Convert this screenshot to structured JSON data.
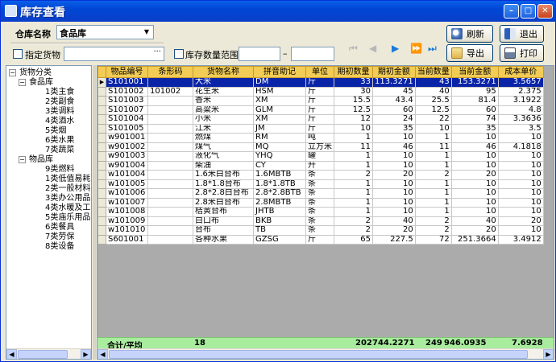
{
  "window": {
    "title": "库存查看"
  },
  "filters": {
    "warehouse_label": "仓库名称",
    "warehouse_value": "食品库",
    "specify_goods_label": "指定货物",
    "specify_goods_value": "",
    "browse_glyph": "···",
    "stock_range_label": "库存数量范围",
    "range_dash": "–",
    "range_min": "",
    "range_max": ""
  },
  "buttons": {
    "refresh": "刷新",
    "exit": "退出",
    "export": "导出",
    "print": "打印"
  },
  "tree": {
    "root": "货物分类",
    "groups": [
      {
        "label": "食品库",
        "children": [
          "1类主食",
          "2类副食",
          "3类调料",
          "4类酒水",
          "5类烟",
          "6类水果",
          "7类蔬菜"
        ]
      },
      {
        "label": "物品库",
        "children": [
          "9类燃料",
          "1类低值易耗",
          "2类一般材料",
          "3类办公用品",
          "4类水暖及工",
          "5类庙乐用品",
          "6类餐具",
          "7类劳保",
          "8类设备"
        ]
      }
    ]
  },
  "grid": {
    "columns": [
      "物品编号",
      "条形码",
      "货物名称",
      "拼音助记",
      "单位",
      "期初数量",
      "期初金额",
      "当前数量",
      "当前金额",
      "成本单价"
    ],
    "rows": [
      [
        "S101001",
        "",
        "大米",
        "DM",
        "斤",
        "33",
        "113.3271",
        "43",
        "153.3271",
        "3.5657"
      ],
      [
        "S101002",
        "101002",
        "花生米",
        "HSM",
        "斤",
        "30",
        "45",
        "40",
        "95",
        "2.375"
      ],
      [
        "S101003",
        "",
        "香米",
        "XM",
        "斤",
        "15.5",
        "43.4",
        "25.5",
        "81.4",
        "3.1922"
      ],
      [
        "S101007",
        "",
        "高粱米",
        "GLM",
        "斤",
        "12.5",
        "60",
        "12.5",
        "60",
        "4.8"
      ],
      [
        "S101004",
        "",
        "小米",
        "XM",
        "斤",
        "12",
        "24",
        "22",
        "74",
        "3.3636"
      ],
      [
        "S101005",
        "",
        "江米",
        "JM",
        "斤",
        "10",
        "35",
        "10",
        "35",
        "3.5"
      ],
      [
        "w901001",
        "",
        "燃煤",
        "RM",
        "吨",
        "1",
        "10",
        "1",
        "10",
        "10"
      ],
      [
        "w901002",
        "",
        "煤气",
        "MQ",
        "立方米",
        "11",
        "46",
        "11",
        "46",
        "4.1818"
      ],
      [
        "w901003",
        "",
        "液化气",
        "YHQ",
        "罐",
        "1",
        "10",
        "1",
        "10",
        "10"
      ],
      [
        "w901004",
        "",
        "柴油",
        "CY",
        "升",
        "1",
        "10",
        "1",
        "10",
        "10"
      ],
      [
        "w101004",
        "",
        "1.6米白台布",
        "1.6MBTB",
        "条",
        "2",
        "20",
        "2",
        "20",
        "10"
      ],
      [
        "w101005",
        "",
        "1.8*1.8台布",
        "1.8*1.8TB",
        "条",
        "1",
        "10",
        "1",
        "10",
        "10"
      ],
      [
        "w101006",
        "",
        "2.8*2.8白台布",
        "2.8*2.8BTB",
        "条",
        "1",
        "10",
        "1",
        "10",
        "10"
      ],
      [
        "w101007",
        "",
        "2.8米白台布",
        "2.8MBTB",
        "条",
        "1",
        "10",
        "1",
        "10",
        "10"
      ],
      [
        "w101008",
        "",
        "桔黄台布",
        "JHTB",
        "条",
        "1",
        "10",
        "1",
        "10",
        "10"
      ],
      [
        "w101009",
        "",
        "白口布",
        "BKB",
        "条",
        "2",
        "40",
        "2",
        "40",
        "20"
      ],
      [
        "w101010",
        "",
        "台布",
        "TB",
        "条",
        "2",
        "20",
        "2",
        "20",
        "10"
      ],
      [
        "S601001",
        "",
        "各种水果",
        "GZSG",
        "斤",
        "65",
        "227.5",
        "72",
        "251.3664",
        "3.4912"
      ]
    ],
    "selected_row": 0,
    "footer": {
      "label": "合计/平均",
      "count": "18",
      "qty_begin": "202",
      "amt_begin": "744.2271",
      "qty_now": "249",
      "amt_now": "946.0935",
      "unit_cost": "7.6928"
    }
  }
}
